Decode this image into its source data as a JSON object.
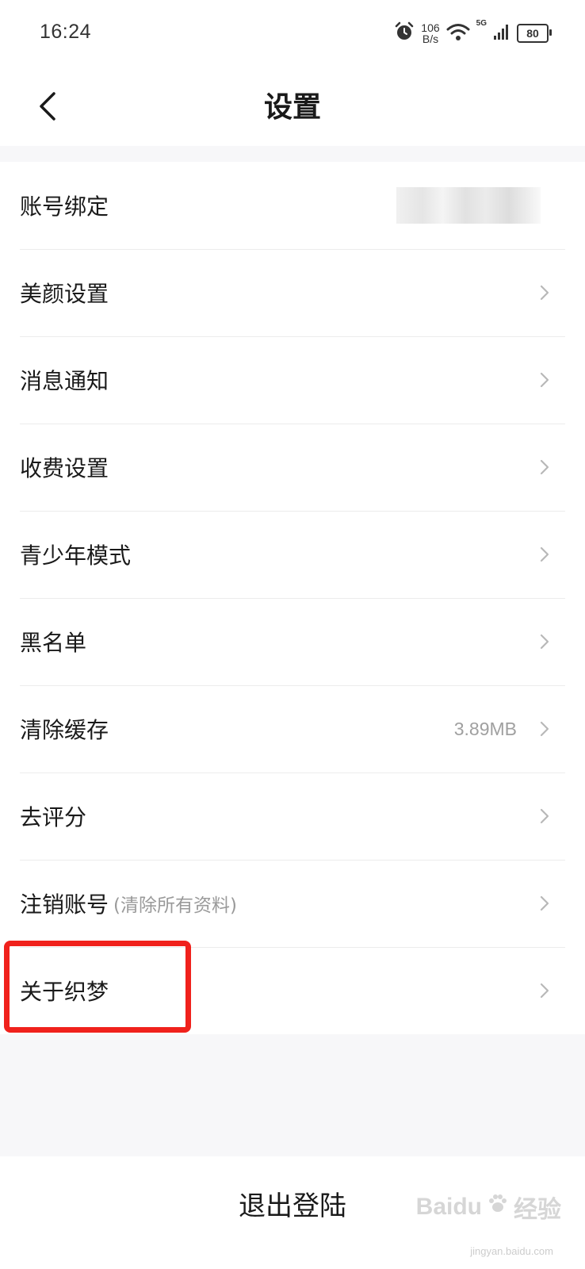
{
  "status_bar": {
    "time": "16:24",
    "speed_value": "106",
    "speed_unit": "B/s",
    "network": "5G",
    "battery": "80"
  },
  "nav": {
    "title": "设置"
  },
  "settings": {
    "items": [
      {
        "label": "账号绑定"
      },
      {
        "label": "美颜设置"
      },
      {
        "label": "消息通知"
      },
      {
        "label": "收费设置"
      },
      {
        "label": "青少年模式"
      },
      {
        "label": "黑名单"
      },
      {
        "label": "清除缓存",
        "value": "3.89MB"
      },
      {
        "label": "去评分"
      },
      {
        "label": "注销账号",
        "note": "(清除所有资料)"
      },
      {
        "label": "关于织梦"
      }
    ]
  },
  "footer": {
    "logout_label": "退出登陆"
  },
  "watermark": {
    "brand": "Baidu",
    "brand_cn": "经验",
    "url": "jingyan.baidu.com"
  },
  "colors": {
    "highlight": "#f0211c",
    "chevron": "#b8b8b8",
    "background": "#f7f7f9"
  }
}
